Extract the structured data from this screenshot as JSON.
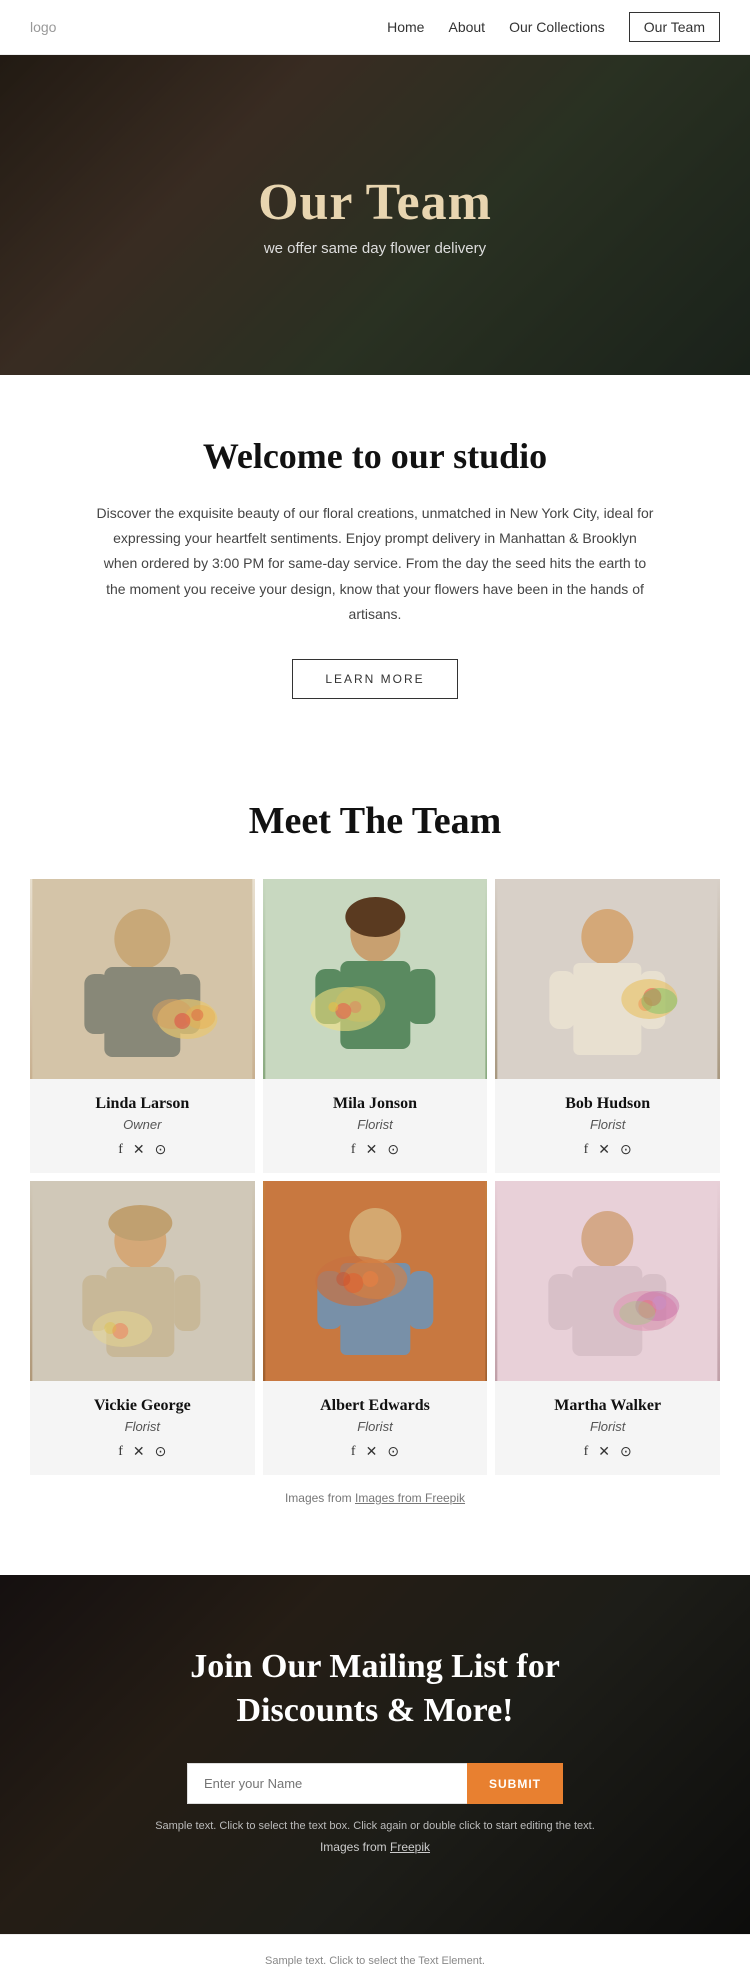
{
  "nav": {
    "logo": "logo",
    "links": [
      {
        "label": "Home",
        "id": "home",
        "active": false
      },
      {
        "label": "About",
        "id": "about",
        "active": false
      },
      {
        "label": "Our Collections",
        "id": "collections",
        "active": false
      },
      {
        "label": "Our Team",
        "id": "team",
        "active": true
      }
    ]
  },
  "hero": {
    "title": "Our Team",
    "subtitle": "we offer same day flower delivery"
  },
  "welcome": {
    "title": "Welcome to our studio",
    "body": "Discover the exquisite beauty of our floral creations, unmatched in New York City, ideal for expressing your heartfelt sentiments. Enjoy prompt delivery in Manhattan & Brooklyn when ordered by 3:00 PM for same-day service.  From the day the seed hits the earth to the moment you receive your design, know that your flowers have been in the hands of artisans.",
    "button": "LEARN MORE"
  },
  "team_section": {
    "title": "Meet The Team",
    "members": [
      {
        "name": "Linda Larson",
        "role": "Owner",
        "id": "linda-larson"
      },
      {
        "name": "Mila Jonson",
        "role": "Florist",
        "id": "mila-jonson"
      },
      {
        "name": "Bob Hudson",
        "role": "Florist",
        "id": "bob-hudson"
      },
      {
        "name": "Vickie George",
        "role": "Florist",
        "id": "vickie-george"
      },
      {
        "name": "Albert Edwards",
        "role": "Florist",
        "id": "albert-edwards"
      },
      {
        "name": "Martha Walker",
        "role": "Florist",
        "id": "martha-walker"
      }
    ],
    "images_credit": "Images from Freepik"
  },
  "mailing": {
    "title": "Join Our Mailing List for Discounts & More!",
    "input_placeholder": "Enter your Name",
    "submit_label": "SUBMIT",
    "sample_text": "Sample text. Click to select the text box. Click again or double click to start editing the text.",
    "credit_prefix": "Images from ",
    "credit_link": "Freepik"
  },
  "footer": {
    "text": "Sample text. Click to select the Text Element."
  },
  "social_icons": {
    "facebook": "f",
    "twitter": "✕",
    "instagram": "⊙"
  }
}
